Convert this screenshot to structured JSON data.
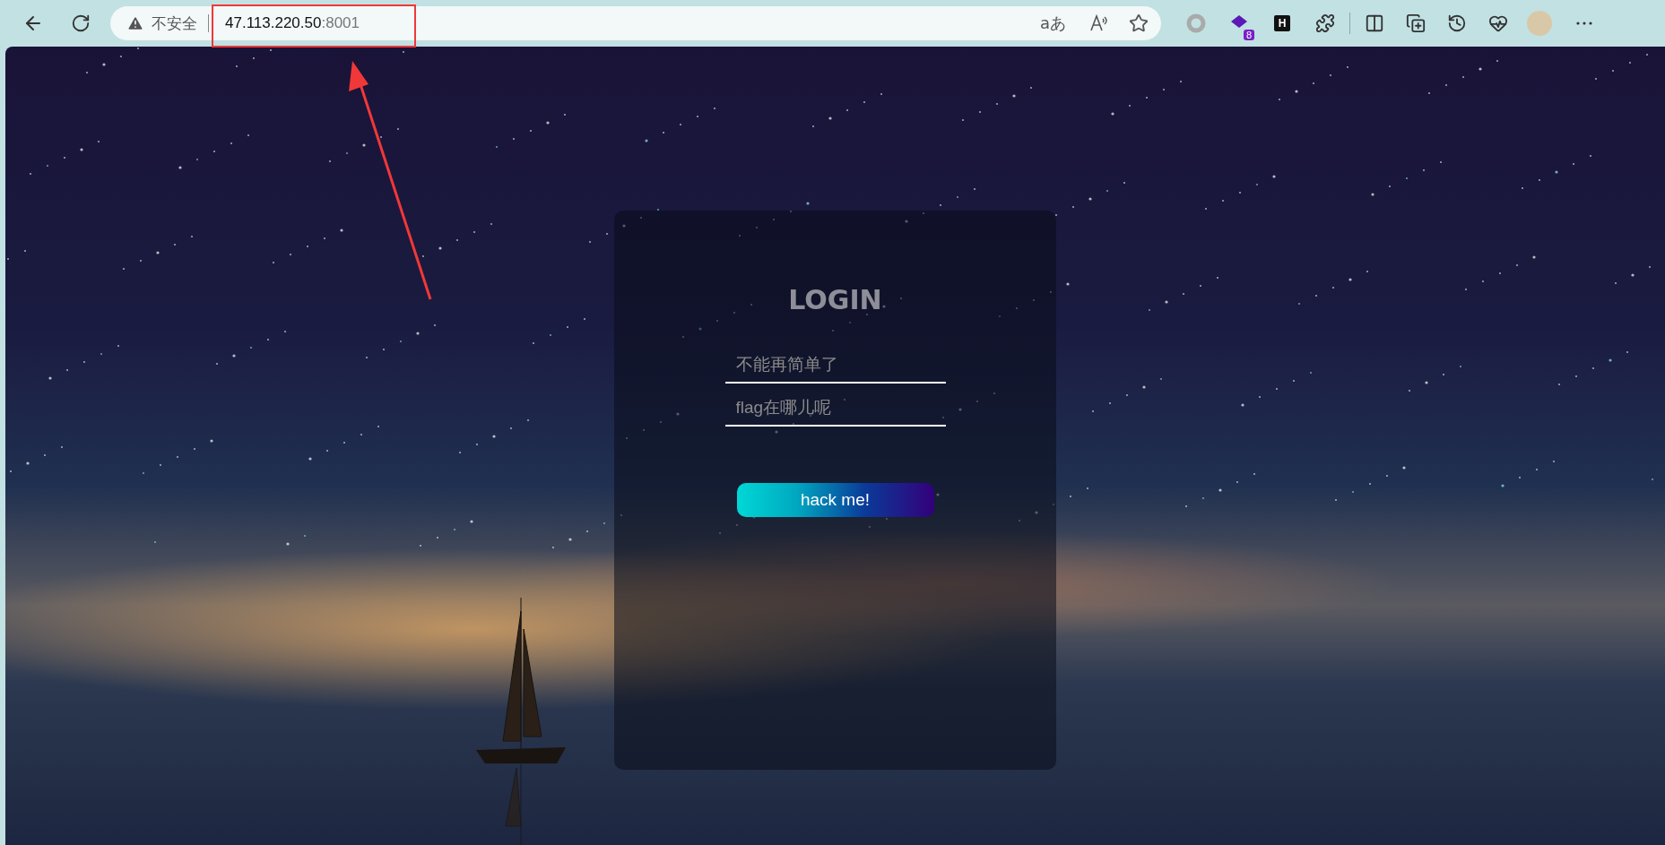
{
  "browser": {
    "security_label": "不安全",
    "url_host": "47.113.220.50",
    "url_port": ":8001",
    "translate_glyph": "aあ",
    "extension_letter": "H",
    "extension_badge": "8"
  },
  "login": {
    "title": "LOGIN",
    "fields": [
      {
        "placeholder": "不能再简单了"
      },
      {
        "placeholder": "flag在哪儿呢"
      }
    ],
    "button": "hack me!"
  }
}
